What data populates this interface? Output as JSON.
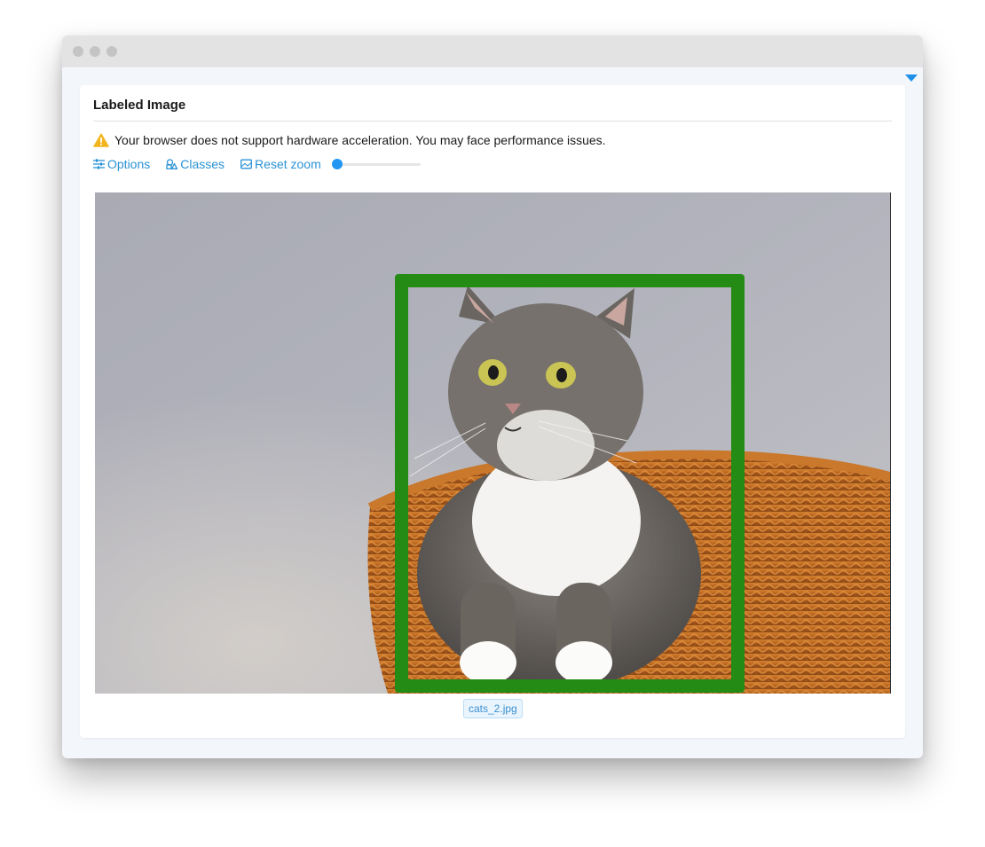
{
  "card": {
    "title": "Labeled Image"
  },
  "warning": {
    "icon": "warning-triangle-icon",
    "text": "Your browser does not support hardware acceleration. You may face performance issues.",
    "color": "#f2b51f"
  },
  "toolbar": {
    "options_label": "Options",
    "classes_label": "Classes",
    "reset_zoom_label": "Reset zoom",
    "zoom_level": 0.0,
    "accent": "#2196f3"
  },
  "image": {
    "filename": "cats_2.jpg",
    "annotation_color": "#248b14"
  }
}
